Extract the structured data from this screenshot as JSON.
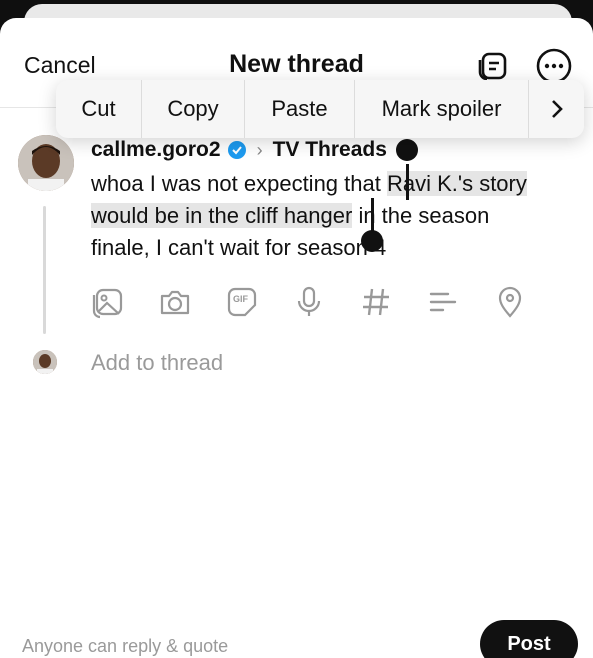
{
  "header": {
    "cancel_label": "Cancel",
    "title": "New thread"
  },
  "context_menu": {
    "items": [
      "Cut",
      "Copy",
      "Paste",
      "Mark spoiler"
    ],
    "next_icon": "chevron-right-icon"
  },
  "post": {
    "username": "callme.goro2",
    "topic": "TV Threads",
    "text_before": "whoa I was not expecting that ",
    "text_selected_1": "Ravi K.'s story",
    "text_selected_2": "would be in the cliff hanger",
    "text_after_1": " in the season",
    "text_after_2": "finale, I can't wait for season 4"
  },
  "toolbar_icons": [
    "image-icon",
    "camera-icon",
    "gif-icon",
    "microphone-icon",
    "hashtag-icon",
    "poll-icon",
    "location-icon"
  ],
  "composer": {
    "add_placeholder": "Add to thread"
  },
  "footer": {
    "hint": "Anyone can reply & quote",
    "post_label": "Post"
  },
  "colors": {
    "verified": "#1d9bf0",
    "selection": "#e5e5e5"
  }
}
